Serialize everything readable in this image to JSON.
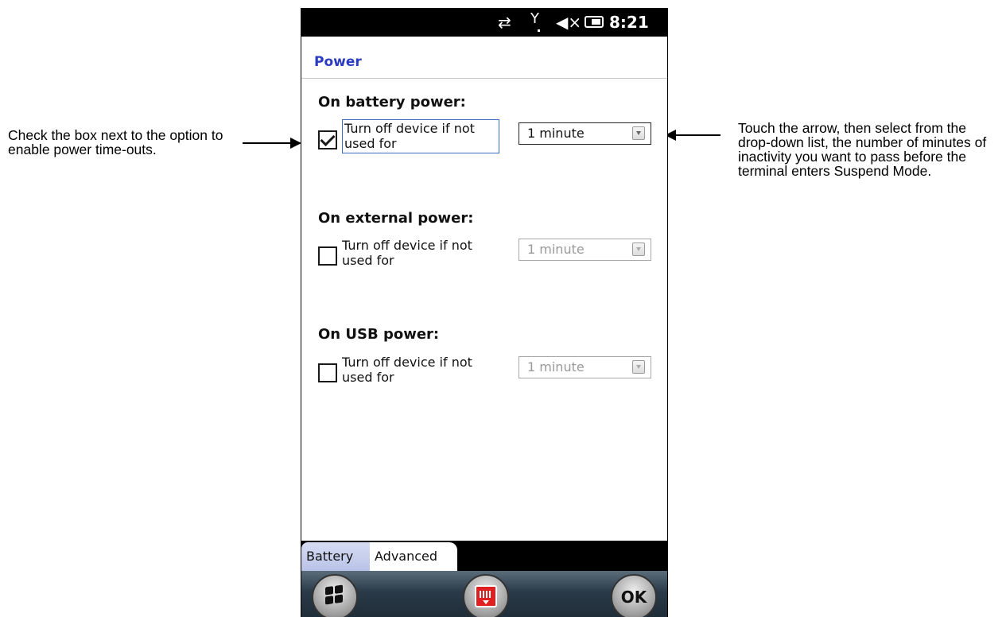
{
  "callouts": {
    "left": "Check the box next to the option to enable power time-outs.",
    "right": "Touch the arrow, then select from the drop-down list, the number of minutes of inactivity you want to pass before the terminal enters Suspend Mode."
  },
  "statusbar": {
    "time": "8:21",
    "sync_icon": "⇄",
    "signal_icon": "Y",
    "volume_icon": "◀×"
  },
  "header": {
    "title": "Power"
  },
  "sections": [
    {
      "heading": "On battery power:",
      "checked": true,
      "option_label": "Turn off device if not used for",
      "dropdown_value": "1 minute",
      "enabled": true
    },
    {
      "heading": "On external power:",
      "checked": false,
      "option_label": "Turn off device if not used for",
      "dropdown_value": "1 minute",
      "enabled": false
    },
    {
      "heading": "On USB power:",
      "checked": false,
      "option_label": "Turn off device if not used for",
      "dropdown_value": "1 minute",
      "enabled": false
    }
  ],
  "tabs": [
    {
      "label": "Battery",
      "active": false
    },
    {
      "label": "Advanced",
      "active": true
    }
  ],
  "softkeys": {
    "ok_label": "OK"
  },
  "colors": {
    "title": "#2a3bbf",
    "focus_border": "#3e68c2"
  }
}
